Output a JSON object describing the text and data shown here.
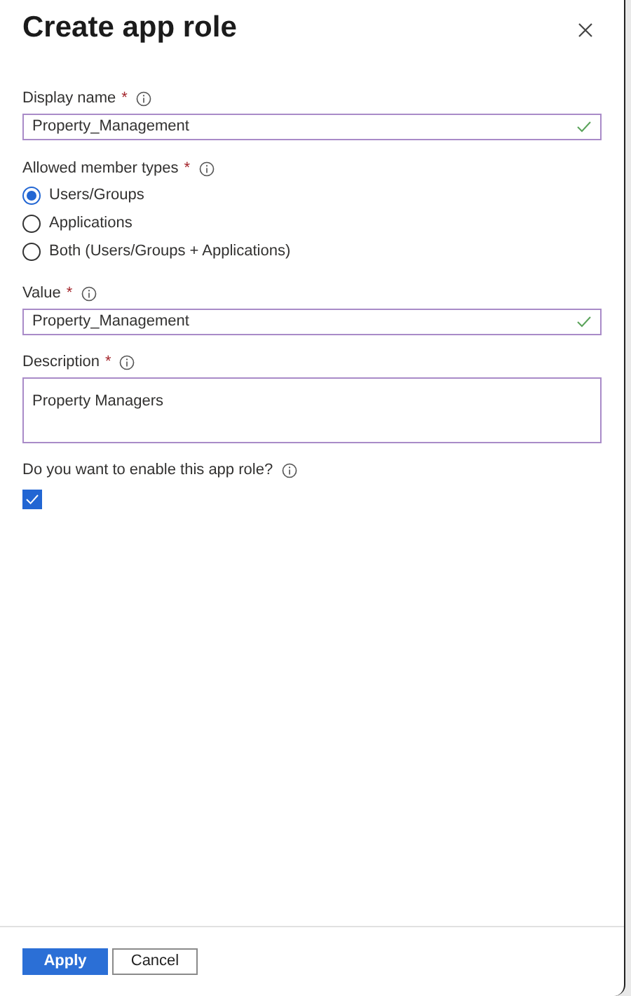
{
  "title": "Create app role",
  "display_name": {
    "label": "Display name",
    "required_mark": "*",
    "value": "Property_Management",
    "valid": true
  },
  "member_types": {
    "label": "Allowed member types",
    "required_mark": "*",
    "options": [
      {
        "label": "Users/Groups",
        "selected": true
      },
      {
        "label": "Applications",
        "selected": false
      },
      {
        "label": "Both (Users/Groups + Applications)",
        "selected": false
      }
    ]
  },
  "value": {
    "label": "Value",
    "required_mark": "*",
    "value": "Property_Management",
    "valid": true
  },
  "description": {
    "label": "Description",
    "required_mark": "*",
    "value": "Property Managers"
  },
  "enable": {
    "label": "Do you want to enable this app role?",
    "checked": true
  },
  "buttons": [
    {
      "label": "Apply",
      "kind": "primary"
    },
    {
      "label": "Cancel",
      "kind": "secondary"
    }
  ]
}
